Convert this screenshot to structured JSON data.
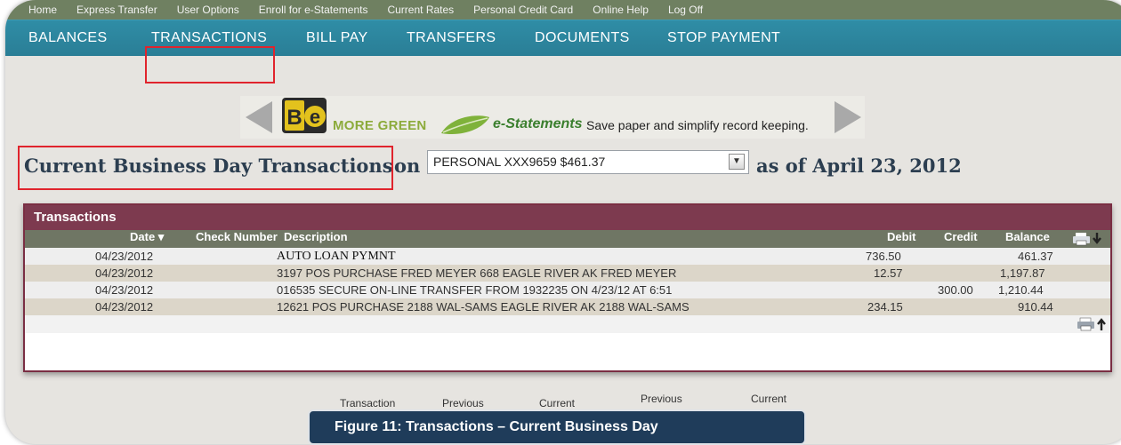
{
  "util_nav": [
    "Home",
    "Express Transfer",
    "User Options",
    "Enroll for e-Statements",
    "Current Rates",
    "Personal Credit Card",
    "Online Help",
    "Log Off"
  ],
  "main_nav": [
    "BALANCES",
    "TRANSACTIONS",
    "BILL PAY",
    "TRANSFERS",
    "DOCUMENTS",
    "STOP PAYMENT"
  ],
  "banner": {
    "logo_text": "Be",
    "more": "MORE GREEN",
    "estatements": "e-Statements",
    "tagline": "Save paper and simplify record keeping."
  },
  "heading": {
    "title": "Current Business Day Transactions",
    "on": "on",
    "account": "PERSONAL XXX9659 $461.37",
    "as_of": "as of April 23, 2012"
  },
  "transactions": {
    "title": "Transactions",
    "columns": {
      "date": "Date ▾",
      "check": "Check Number",
      "description": "Description",
      "debit": "Debit",
      "credit": "Credit",
      "balance": "Balance"
    },
    "rows": [
      {
        "date": "04/23/2012",
        "description": "AUTO LOAN PYMNT",
        "debit": "736.50",
        "credit": "",
        "balance": "461.37"
      },
      {
        "date": "04/23/2012",
        "description": "3197 POS PURCHASE FRED MEYER 668 EAGLE RIVER AK FRED MEYER",
        "debit": "12.57",
        "credit": "",
        "balance": "1,197.87"
      },
      {
        "date": "04/23/2012",
        "description": "016535 SECURE ON-LINE TRANSFER FROM 1932235 ON 4/23/12 AT 6:51",
        "debit": "",
        "credit": "300.00",
        "balance": "1,210.44"
      },
      {
        "date": "04/23/2012",
        "description": "12621 POS PURCHASE 2188 WAL-SAMS EAGLE RIVER AK 2188 WAL-SAMS",
        "debit": "234.15",
        "credit": "",
        "balance": "910.44"
      }
    ]
  },
  "footer_links": [
    "Transaction",
    "Previous",
    "Current",
    "Previous",
    "Current"
  ],
  "tooltip": "Figure 11: Transactions – Current Business Day",
  "colors": {
    "util_bar": "#6f8061",
    "main_nav": "#2a7e96",
    "highlight": "#e0242d",
    "panel_header": "#7d3a4f",
    "table_header": "#6f7664",
    "heading": "#2c3e50"
  }
}
